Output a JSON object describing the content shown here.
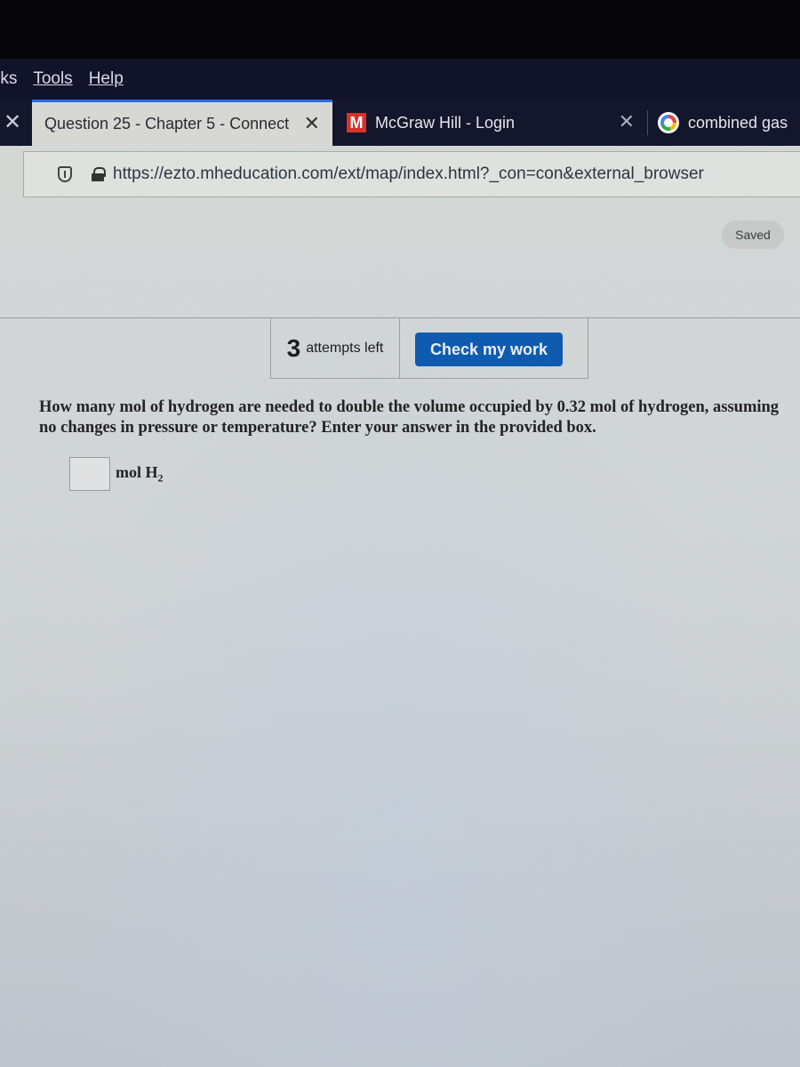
{
  "menubar": {
    "items": [
      {
        "label": "rks"
      },
      {
        "label": "Tools"
      },
      {
        "label": "Help"
      }
    ]
  },
  "tabs": [
    {
      "label": "Question 25 - Chapter 5 - Connect",
      "active": true,
      "close": "✕"
    },
    {
      "label": "McGraw Hill - Login",
      "favicon": "M",
      "close": "✕"
    },
    {
      "label": "combined gas",
      "favicon": "google-icon"
    }
  ],
  "tab_close_left": "✕",
  "addressbar": {
    "url": "https://ezto.mheducation.com/ext/map/index.html?_con=con&external_browser"
  },
  "status": {
    "saved": "Saved"
  },
  "attempts": {
    "count": "3",
    "label": "attempts left"
  },
  "check_button": {
    "label": "Check my work",
    "color": "#0f5bb0"
  },
  "question": {
    "text": "How many mol of hydrogen are needed to double the volume occupied by 0.32 mol of hydrogen, assuming no changes in pressure or temperature? Enter your answer in the provided box.",
    "answer_value": "",
    "unit_prefix": "mol H",
    "unit_subscript": "2"
  }
}
